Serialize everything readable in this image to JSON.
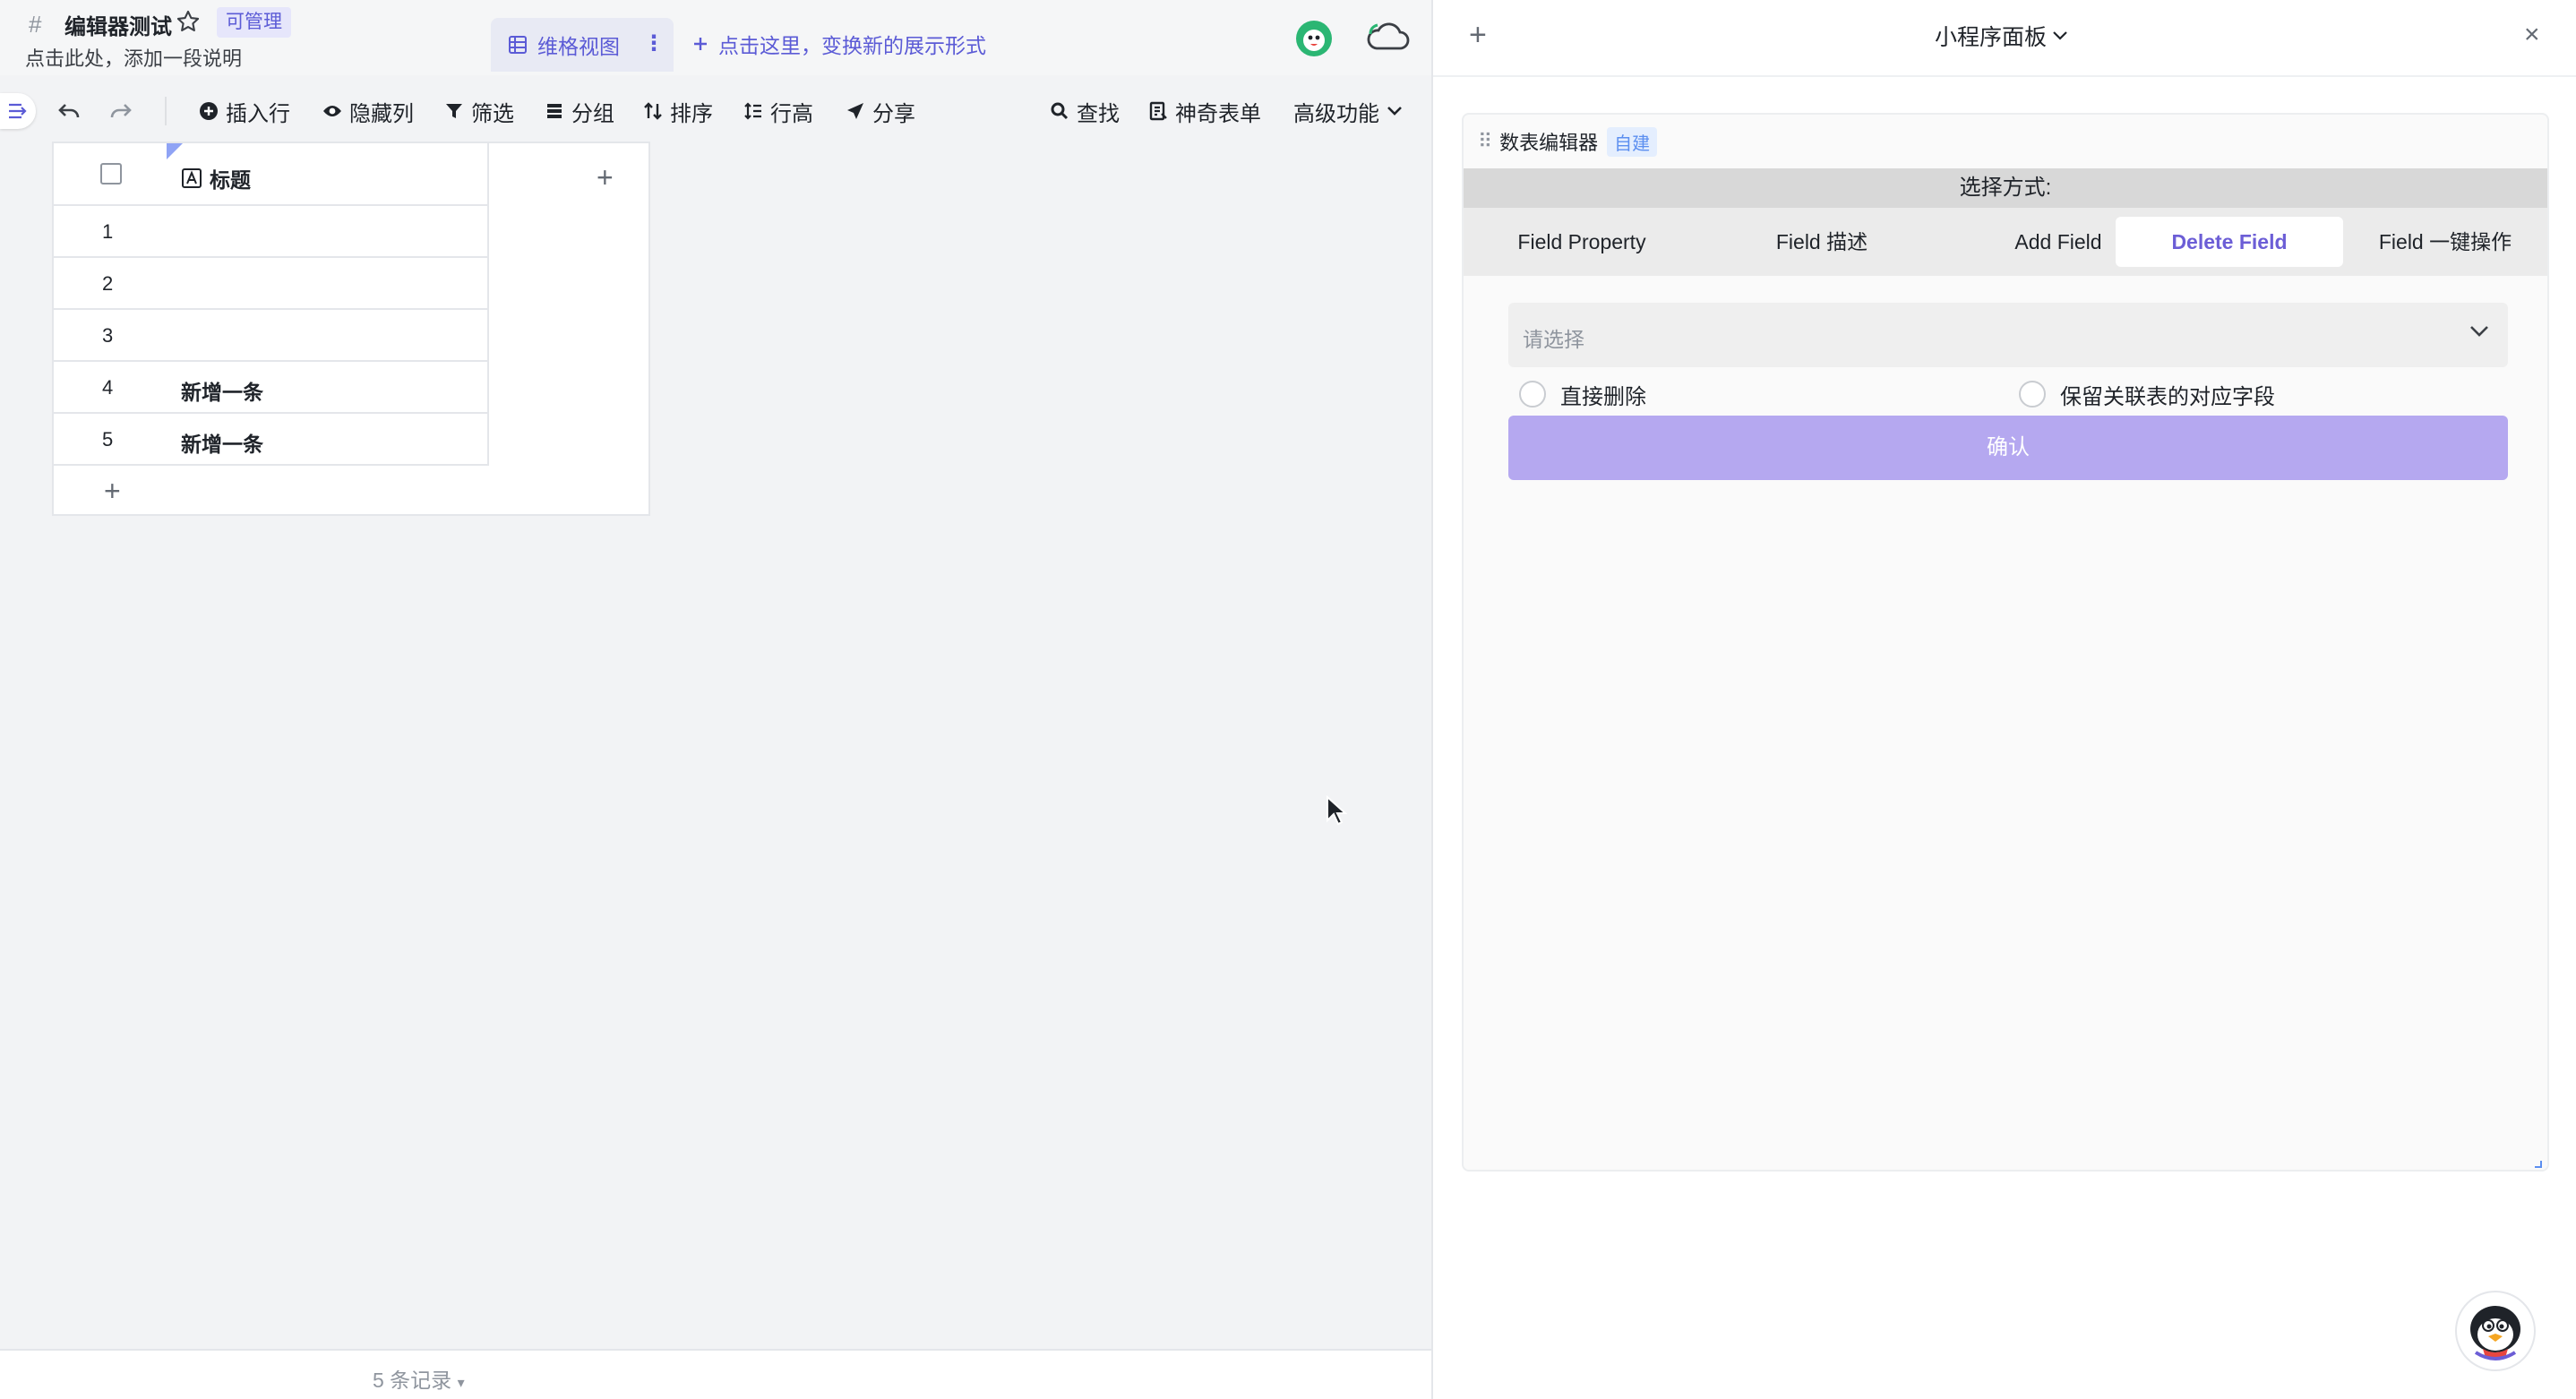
{
  "header": {
    "hash": "#",
    "doc_title": "编辑器测试",
    "badge": "可管理",
    "subtitle": "点击此处，添加一段说明",
    "view_tab_label": "维格视图",
    "view_more": "⋮",
    "new_view_label": "点击这里，变换新的展示形式"
  },
  "toolbar": {
    "insert_row": "插入行",
    "hide_col": "隐藏列",
    "filter": "筛选",
    "group": "分组",
    "sort": "排序",
    "row_height": "行高",
    "share": "分享",
    "search": "查找",
    "magic_form": "神奇表单",
    "advanced": "高级功能"
  },
  "grid": {
    "column_title": "标题",
    "add_column": "+",
    "add_row": "+",
    "rows": [
      {
        "num": "1",
        "title": ""
      },
      {
        "num": "2",
        "title": ""
      },
      {
        "num": "3",
        "title": ""
      },
      {
        "num": "4",
        "title": "新增一条"
      },
      {
        "num": "5",
        "title": "新增一条"
      }
    ]
  },
  "footer": {
    "record_count": "5 条记录",
    "caret": "▾"
  },
  "panel": {
    "add": "+",
    "title": "小程序面板",
    "close": "×",
    "widget": {
      "drag": "⠿",
      "name": "数表编辑器",
      "tag": "自建",
      "select_label": "选择方式:",
      "tabs": [
        {
          "label": "Field Property",
          "active": false
        },
        {
          "label": "Field 描述",
          "active": false
        },
        {
          "label": "Add Field",
          "active": false
        },
        {
          "label": "Delete Field",
          "active": true
        },
        {
          "label": "Field 一键操作",
          "active": false
        }
      ],
      "select_placeholder": "请选择",
      "radio_direct_delete": "直接删除",
      "radio_keep_linked": "保留关联表的对应字段",
      "confirm": "确认"
    }
  },
  "colors": {
    "accent": "#5b5bd6",
    "confirm_bg": "#b5a8f0",
    "active_tab": "#6c5ed6"
  }
}
